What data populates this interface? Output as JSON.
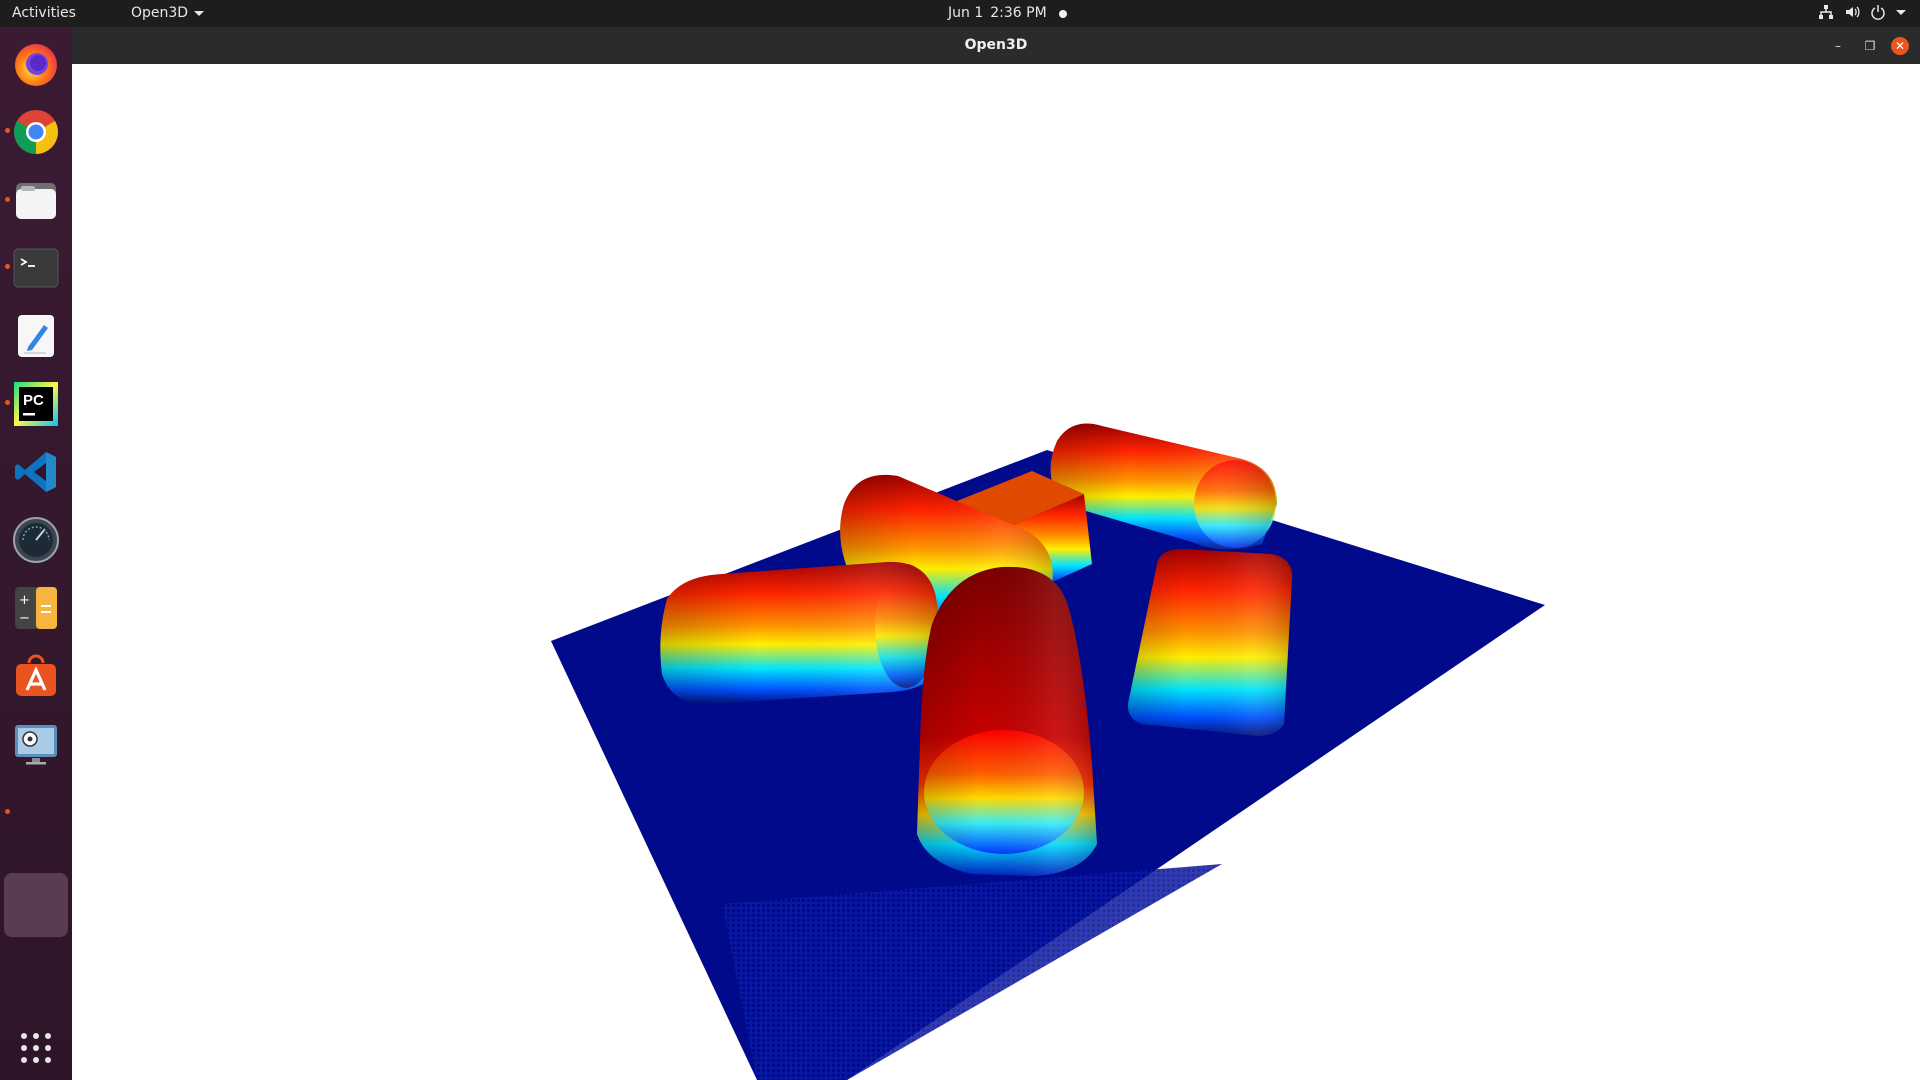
{
  "topbar": {
    "activities": "Activities",
    "app_menu": "Open3D",
    "date": "Jun 1",
    "time": "2:36 PM"
  },
  "window": {
    "title": "Open3D",
    "minimize": "–",
    "restore": "❐",
    "close": "✕"
  },
  "dock": {
    "items": [
      {
        "name": "firefox-icon",
        "running": false
      },
      {
        "name": "chrome-icon",
        "running": true
      },
      {
        "name": "files-icon",
        "running": true
      },
      {
        "name": "terminal-icon",
        "running": true
      },
      {
        "name": "text-editor-icon",
        "running": false
      },
      {
        "name": "pycharm-icon",
        "running": true
      },
      {
        "name": "vscode-icon",
        "running": false
      },
      {
        "name": "disk-usage-icon",
        "running": false
      },
      {
        "name": "calculator-icon",
        "running": false
      },
      {
        "name": "software-center-icon",
        "running": false
      },
      {
        "name": "screenshot-tool-icon",
        "running": false
      }
    ],
    "apps_grid": "show-applications-icon"
  },
  "scene": {
    "ground_color": "#020a8c",
    "object_palette": [
      "#8a0000",
      "#ff2a00",
      "#ff9000",
      "#ffee00",
      "#00e5ff",
      "#0050ff",
      "#001070"
    ]
  }
}
